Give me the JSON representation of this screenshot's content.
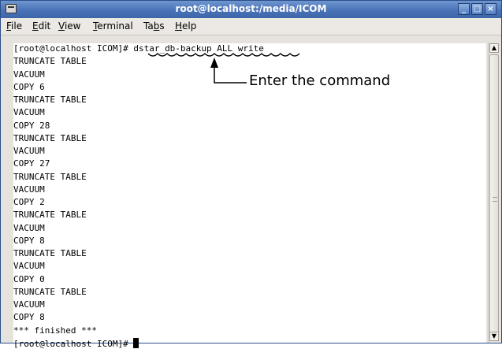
{
  "window": {
    "title": "root@localhost:/media/ICOM",
    "buttons": [
      "minimize",
      "maximize",
      "close"
    ]
  },
  "menu": {
    "items": [
      {
        "label": "File",
        "underline": "F"
      },
      {
        "label": "Edit",
        "underline": "E"
      },
      {
        "label": "View",
        "underline": "V"
      },
      {
        "label": "Terminal",
        "underline": "T"
      },
      {
        "label": "Tabs",
        "underline": "b"
      },
      {
        "label": "Help",
        "underline": "H"
      }
    ]
  },
  "terminal": {
    "prompt": "[root@localhost ICOM]#",
    "command": "dstar_db-backup ALL write",
    "output": [
      "TRUNCATE TABLE",
      "VACUUM",
      "COPY 6",
      "TRUNCATE TABLE",
      "VACUUM",
      "COPY 28",
      "TRUNCATE TABLE",
      "VACUUM",
      "COPY 27",
      "TRUNCATE TABLE",
      "VACUUM",
      "COPY 2",
      "TRUNCATE TABLE",
      "VACUUM",
      "COPY 8",
      "TRUNCATE TABLE",
      "VACUUM",
      "COPY 0",
      "TRUNCATE TABLE",
      "VACUUM",
      "COPY 8",
      "*** finished ***"
    ],
    "final_prompt": "[root@localhost ICOM]#"
  },
  "annotation": {
    "text": "Enter the command"
  },
  "colors": {
    "titlebar": "#4a73b8",
    "terminal_bg": "#ffffff"
  }
}
